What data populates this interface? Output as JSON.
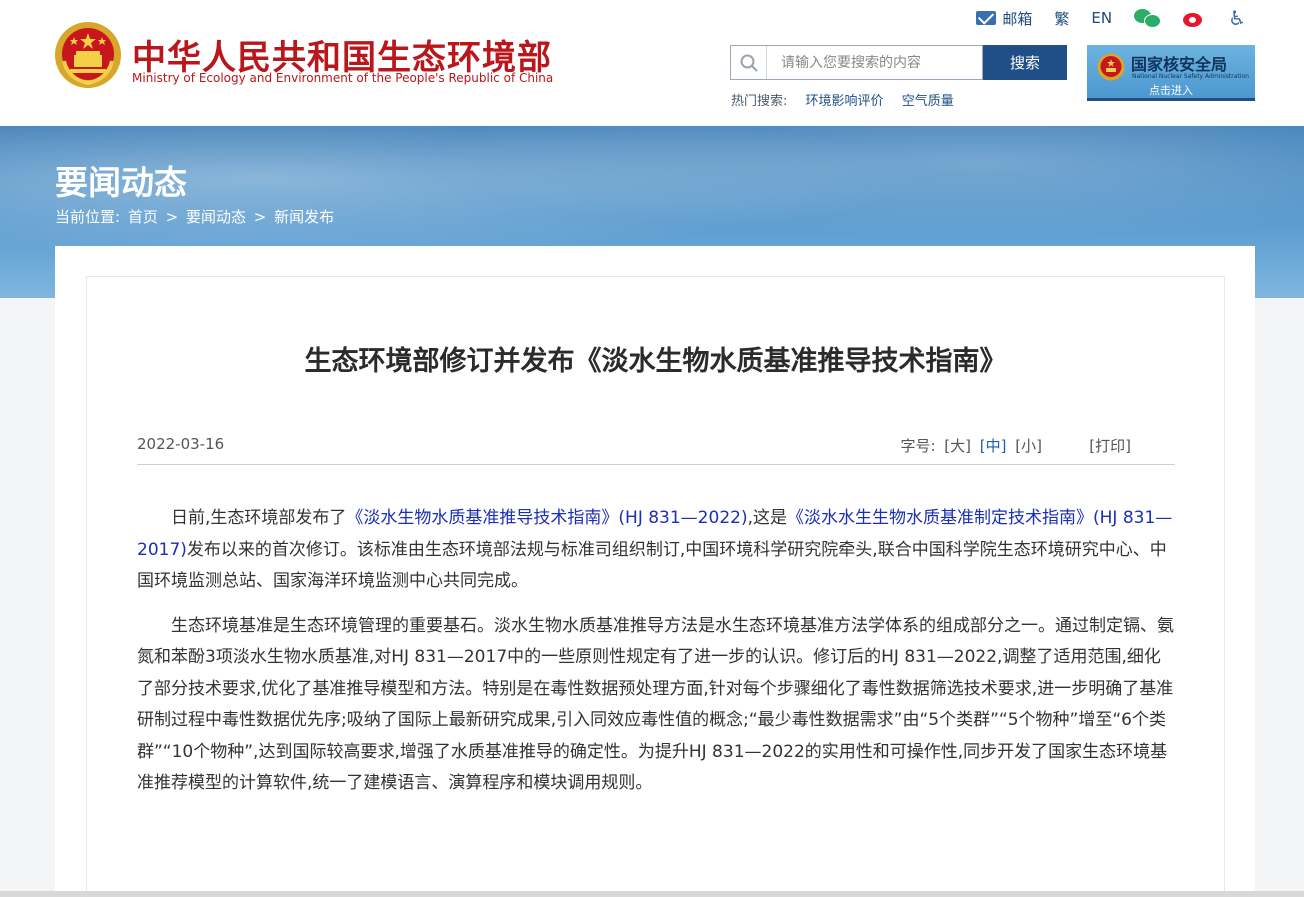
{
  "header": {
    "site_title": "中华人民共和国生态环境部",
    "site_subtitle": "Ministry of Ecology and Environment of the People's Republic of China",
    "toplinks": {
      "mail": "邮箱",
      "traditional": "繁",
      "english": "EN"
    },
    "search": {
      "placeholder": "请输入您要搜索的内容",
      "button": "搜索"
    },
    "hot": {
      "label": "热门搜索:",
      "keywords": [
        "环境影响评价",
        "空气质量"
      ]
    },
    "nnsa": {
      "name": "国家核安全局",
      "english": "National Nuclear Safety Administration",
      "enter": "点击进入"
    }
  },
  "banner": {
    "title": "要闻动态",
    "breadcrumb": {
      "label": "当前位置:",
      "items": [
        "首页",
        "要闻动态",
        "新闻发布"
      ],
      "separator": ">"
    }
  },
  "article": {
    "title": "生态环境部修订并发布《淡水生物水质基准推导技术指南》",
    "date": "2022-03-16",
    "fontsize": {
      "label": "字号:",
      "large": "[大]",
      "medium": "[中]",
      "small": "[小]"
    },
    "print": "[打印]",
    "p1": {
      "a": "日前,生态环境部发布了",
      "link1": "《淡水生物水质基准推导技术指南》(HJ 831—2022)",
      "b": ",这是",
      "link2": "《淡水水生生物水质基准制定技术指南》(HJ 831—2017)",
      "c": "发布以来的首次修订。该标准由生态环境部法规与标准司组织制订,中国环境科学研究院牵头,联合中国科学院生态环境研究中心、中国环境监测总站、国家海洋环境监测中心共同完成。"
    },
    "p2": "生态环境基准是生态环境管理的重要基石。淡水生物水质基准推导方法是水生态环境基准方法学体系的组成部分之一。通过制定镉、氨氮和苯酚3项淡水生物水质基准,对HJ 831—2017中的一些原则性规定有了进一步的认识。修订后的HJ 831—2022,调整了适用范围,细化了部分技术要求,优化了基准推导模型和方法。特别是在毒性数据预处理方面,针对每个步骤细化了毒性数据筛选技术要求,进一步明确了基准研制过程中毒性数据优先序;吸纳了国际上最新研究成果,引入同效应毒性值的概念;“最少毒性数据需求”由“5个类群”“5个物种”增至“6个类群”“10个物种”,达到国际较高要求,增强了水质基准推导的确定性。为提升HJ 831—2022的实用性和可操作性,同步开发了国家生态环境基准推荐模型的计算软件,统一了建模语言、演算程序和模块调用规则。"
  },
  "colors": {
    "brand_red": "#b9171c",
    "nav_blue": "#1f4f86",
    "link_blue": "#1a2fb6"
  },
  "icons": [
    "national-emblem-icon",
    "mail-icon",
    "wechat-icon",
    "weibo-icon",
    "accessibility-icon",
    "search-icon"
  ]
}
